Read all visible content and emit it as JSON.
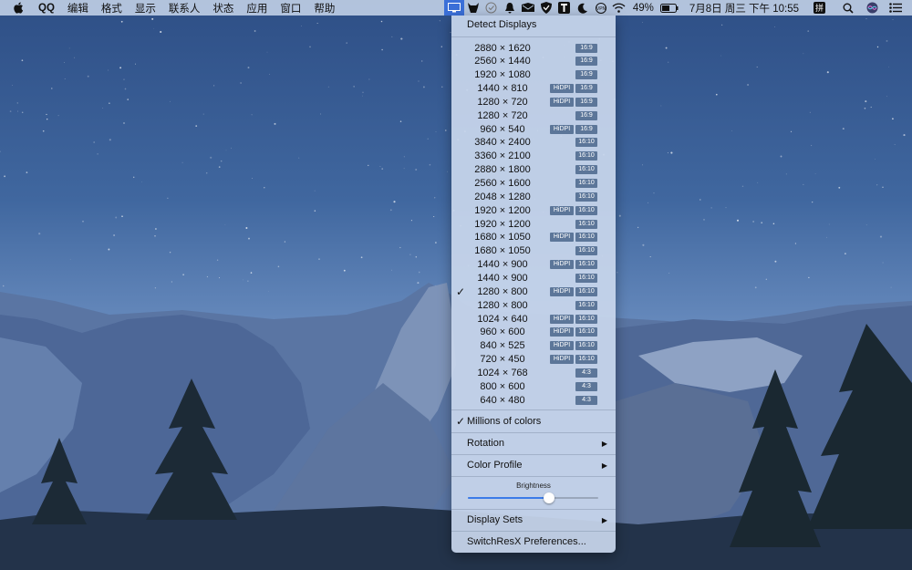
{
  "menubar": {
    "app_name": "QQ",
    "menus": [
      "编辑",
      "格式",
      "显示",
      "联系人",
      "状态",
      "应用",
      "窗口",
      "帮助"
    ],
    "battery": "49%",
    "datetime": "7月8日 周三 下午 10:55"
  },
  "dropdown": {
    "detect_label": "Detect Displays",
    "hidpi_label": "HiDPI",
    "resolutions": [
      {
        "res": "2880 × 1620",
        "hidpi": false,
        "ratio": "16:9",
        "checked": false
      },
      {
        "res": "2560 × 1440",
        "hidpi": false,
        "ratio": "16:9",
        "checked": false
      },
      {
        "res": "1920 × 1080",
        "hidpi": false,
        "ratio": "16:9",
        "checked": false
      },
      {
        "res": "1440 × 810",
        "hidpi": true,
        "ratio": "16:9",
        "checked": false
      },
      {
        "res": "1280 × 720",
        "hidpi": true,
        "ratio": "16:9",
        "checked": false
      },
      {
        "res": "1280 × 720",
        "hidpi": false,
        "ratio": "16:9",
        "checked": false
      },
      {
        "res": "960 × 540",
        "hidpi": true,
        "ratio": "16:9",
        "checked": false
      },
      {
        "res": "3840 × 2400",
        "hidpi": false,
        "ratio": "16:10",
        "checked": false
      },
      {
        "res": "3360 × 2100",
        "hidpi": false,
        "ratio": "16:10",
        "checked": false
      },
      {
        "res": "2880 × 1800",
        "hidpi": false,
        "ratio": "16:10",
        "checked": false
      },
      {
        "res": "2560 × 1600",
        "hidpi": false,
        "ratio": "16:10",
        "checked": false
      },
      {
        "res": "2048 × 1280",
        "hidpi": false,
        "ratio": "16:10",
        "checked": false
      },
      {
        "res": "1920 × 1200",
        "hidpi": true,
        "ratio": "16:10",
        "checked": false
      },
      {
        "res": "1920 × 1200",
        "hidpi": false,
        "ratio": "16:10",
        "checked": false
      },
      {
        "res": "1680 × 1050",
        "hidpi": true,
        "ratio": "16:10",
        "checked": false
      },
      {
        "res": "1680 × 1050",
        "hidpi": false,
        "ratio": "16:10",
        "checked": false
      },
      {
        "res": "1440 × 900",
        "hidpi": true,
        "ratio": "16:10",
        "checked": false
      },
      {
        "res": "1440 × 900",
        "hidpi": false,
        "ratio": "16:10",
        "checked": false
      },
      {
        "res": "1280 × 800",
        "hidpi": true,
        "ratio": "16:10",
        "checked": true
      },
      {
        "res": "1280 × 800",
        "hidpi": false,
        "ratio": "16:10",
        "checked": false
      },
      {
        "res": "1024 × 640",
        "hidpi": true,
        "ratio": "16:10",
        "checked": false
      },
      {
        "res": "960 × 600",
        "hidpi": true,
        "ratio": "16:10",
        "checked": false
      },
      {
        "res": "840 × 525",
        "hidpi": true,
        "ratio": "16:10",
        "checked": false
      },
      {
        "res": "720 × 450",
        "hidpi": true,
        "ratio": "16:10",
        "checked": false
      },
      {
        "res": "1024 × 768",
        "hidpi": false,
        "ratio": "4:3",
        "checked": false
      },
      {
        "res": "800 × 600",
        "hidpi": false,
        "ratio": "4:3",
        "checked": false
      },
      {
        "res": "640 × 480",
        "hidpi": false,
        "ratio": "4:3",
        "checked": false
      }
    ],
    "millions_label": "Millions of colors",
    "rotation_label": "Rotation",
    "color_profile_label": "Color Profile",
    "brightness_label": "Brightness",
    "brightness_value": 0.62,
    "display_sets_label": "Display Sets",
    "preferences_label": "SwitchResX Preferences..."
  },
  "icons": [
    "apple-icon",
    "display-icon",
    "horned-icon",
    "check-circle-icon",
    "bell-icon",
    "mail-icon",
    "shield-icon",
    "text-t-icon",
    "moon-icon",
    "vpn-icon",
    "wifi-icon",
    "battery-icon",
    "input-method-icon",
    "search-icon",
    "siri-icon",
    "list-icon"
  ],
  "colors": {
    "accent": "#3b6fd8",
    "badge": "#5c7699",
    "slider": "#3b7be8"
  }
}
